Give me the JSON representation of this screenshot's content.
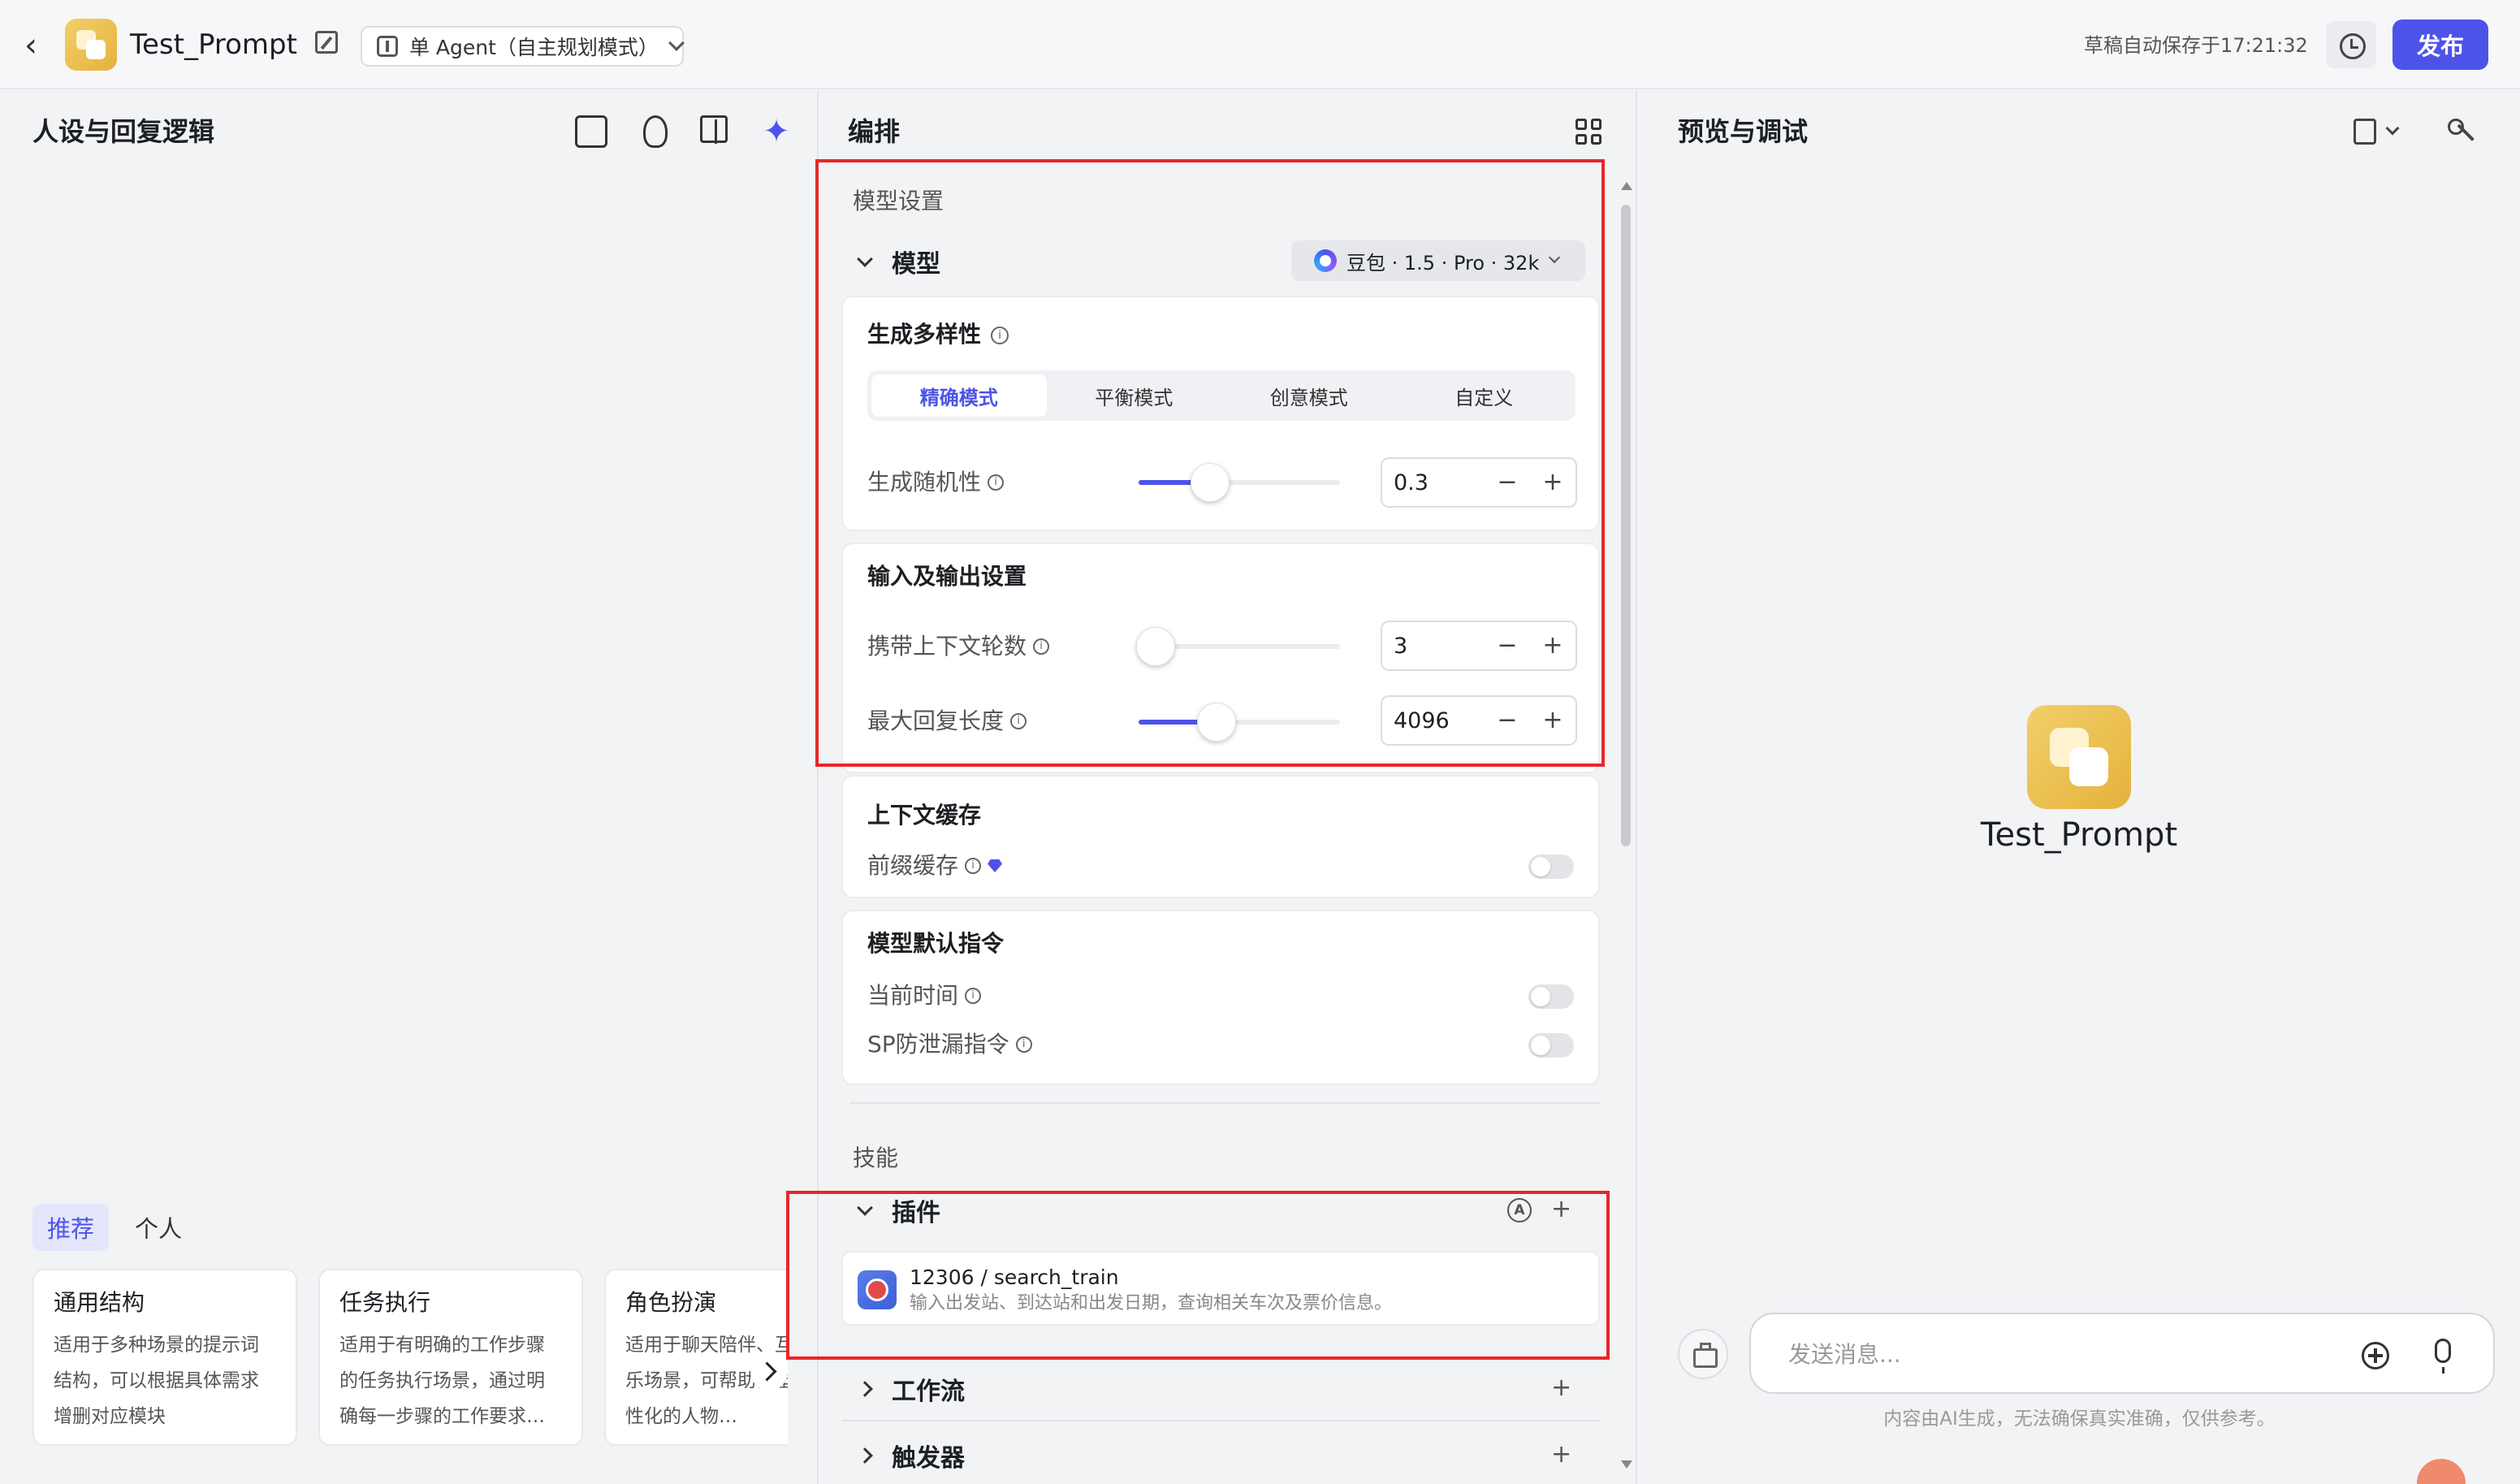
{
  "header": {
    "app_title": "Test_Prompt",
    "mode_label": "单 Agent（自主规划模式）",
    "autosave_text": "草稿自动保存于17:21:32",
    "publish_label": "发布"
  },
  "left": {
    "title": "人设与回复逻辑",
    "tabs": [
      {
        "label": "推荐",
        "active": true
      },
      {
        "label": "个人",
        "active": false
      }
    ],
    "templates": [
      {
        "name": "通用结构",
        "desc": "适用于多种场景的提示词结构，可以根据具体需求增删对应模块"
      },
      {
        "name": "任务执行",
        "desc": "适用于有明确的工作步骤的任务执行场景，通过明确每一步骤的工作要求…"
      },
      {
        "name": "角色扮演",
        "desc": "适用于聊天陪伴、互动娱乐场景，可帮助你塑造个性化的人物…"
      }
    ]
  },
  "middle": {
    "title": "编排",
    "model_settings_label": "模型设置",
    "model_label": "模型",
    "model_value": "豆包 · 1.5 · Pro · 32k",
    "diversity": {
      "title": "生成多样性",
      "modes": [
        {
          "label": "精确模式",
          "active": true
        },
        {
          "label": "平衡模式",
          "active": false
        },
        {
          "label": "创意模式",
          "active": false
        },
        {
          "label": "自定义",
          "active": false
        }
      ],
      "randomness_label": "生成随机性",
      "randomness_value": "0.3",
      "randomness_level": 0.3
    },
    "io": {
      "title": "输入及输出设置",
      "context_rounds_label": "携带上下文轮数",
      "context_rounds_value": "3",
      "context_rounds_level": 0.03,
      "max_length_label": "最大回复长度",
      "max_length_value": "4096",
      "max_length_level": 0.33
    },
    "cache": {
      "title": "上下文缓存",
      "prefix_cache_label": "前缀缓存",
      "prefix_cache_on": false
    },
    "default_instructions": {
      "title": "模型默认指令",
      "current_time_label": "当前时间",
      "current_time_on": false,
      "sp_leak_label": "SP防泄漏指令",
      "sp_leak_on": false
    },
    "skills_label": "技能",
    "plugins": {
      "label": "插件",
      "auto_badge": "A",
      "items": [
        {
          "name": "12306 / search_train",
          "desc": "输入出发站、到达站和出发日期，查询相关车次及票价信息。"
        }
      ]
    },
    "workflow_label": "工作流",
    "trigger_label": "触发器"
  },
  "right": {
    "title": "预览与调试",
    "bot_name": "Test_Prompt",
    "input_placeholder": "发送消息...",
    "disclaimer": "内容由AI生成，无法确保真实准确，仅供参考。"
  },
  "colors": {
    "accent": "#4d53e8",
    "highlight": "#e8262b",
    "logo": "#e5b23c"
  }
}
